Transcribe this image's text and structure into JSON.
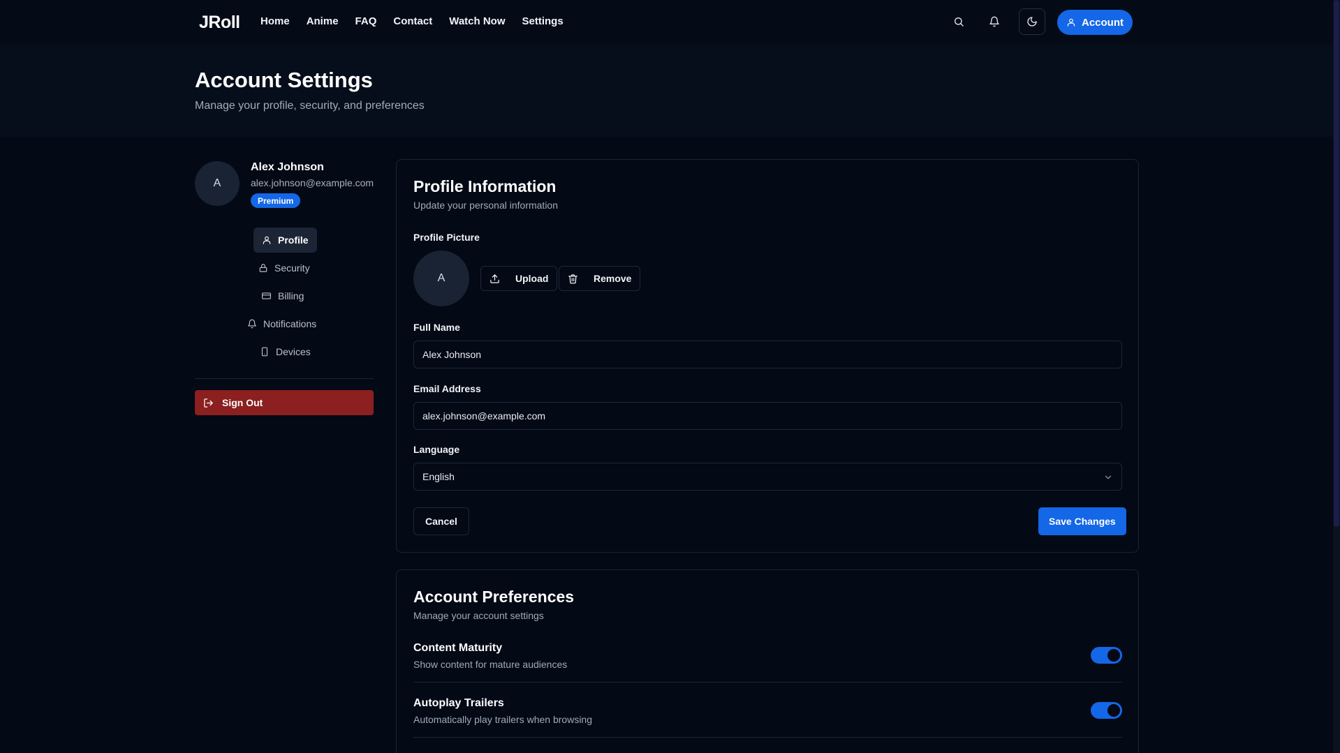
{
  "nav": {
    "logo": "JRoll",
    "links": [
      "Home",
      "Anime",
      "FAQ",
      "Contact",
      "Watch Now",
      "Settings"
    ],
    "account_label": "Account"
  },
  "header": {
    "title": "Account Settings",
    "subtitle": "Manage your profile, security, and preferences"
  },
  "user": {
    "initial": "A",
    "name": "Alex Johnson",
    "email": "alex.johnson@example.com",
    "badge": "Premium"
  },
  "sidebar": {
    "items": [
      {
        "label": "Profile",
        "icon": "user-icon",
        "active": true
      },
      {
        "label": "Security",
        "icon": "lock-icon",
        "active": false
      },
      {
        "label": "Billing",
        "icon": "credit-card-icon",
        "active": false
      },
      {
        "label": "Notifications",
        "icon": "bell-icon",
        "active": false
      },
      {
        "label": "Devices",
        "icon": "smartphone-icon",
        "active": false
      }
    ],
    "signout_label": "Sign Out"
  },
  "profile_card": {
    "title": "Profile Information",
    "subtitle": "Update your personal information",
    "picture_label": "Profile Picture",
    "picture_initial": "A",
    "upload_label": "Upload",
    "remove_label": "Remove",
    "full_name_label": "Full Name",
    "full_name_value": "Alex Johnson",
    "email_label": "Email Address",
    "email_value": "alex.johnson@example.com",
    "language_label": "Language",
    "language_value": "English",
    "cancel_label": "Cancel",
    "save_label": "Save Changes"
  },
  "preferences_card": {
    "title": "Account Preferences",
    "subtitle": "Manage your account settings",
    "items": [
      {
        "title": "Content Maturity",
        "desc": "Show content for mature audiences",
        "enabled": true
      },
      {
        "title": "Autoplay Trailers",
        "desc": "Automatically play trailers when browsing",
        "enabled": true
      }
    ]
  },
  "colors": {
    "background": "#030915",
    "accent": "#1467e6",
    "danger": "#8c1f1f"
  }
}
